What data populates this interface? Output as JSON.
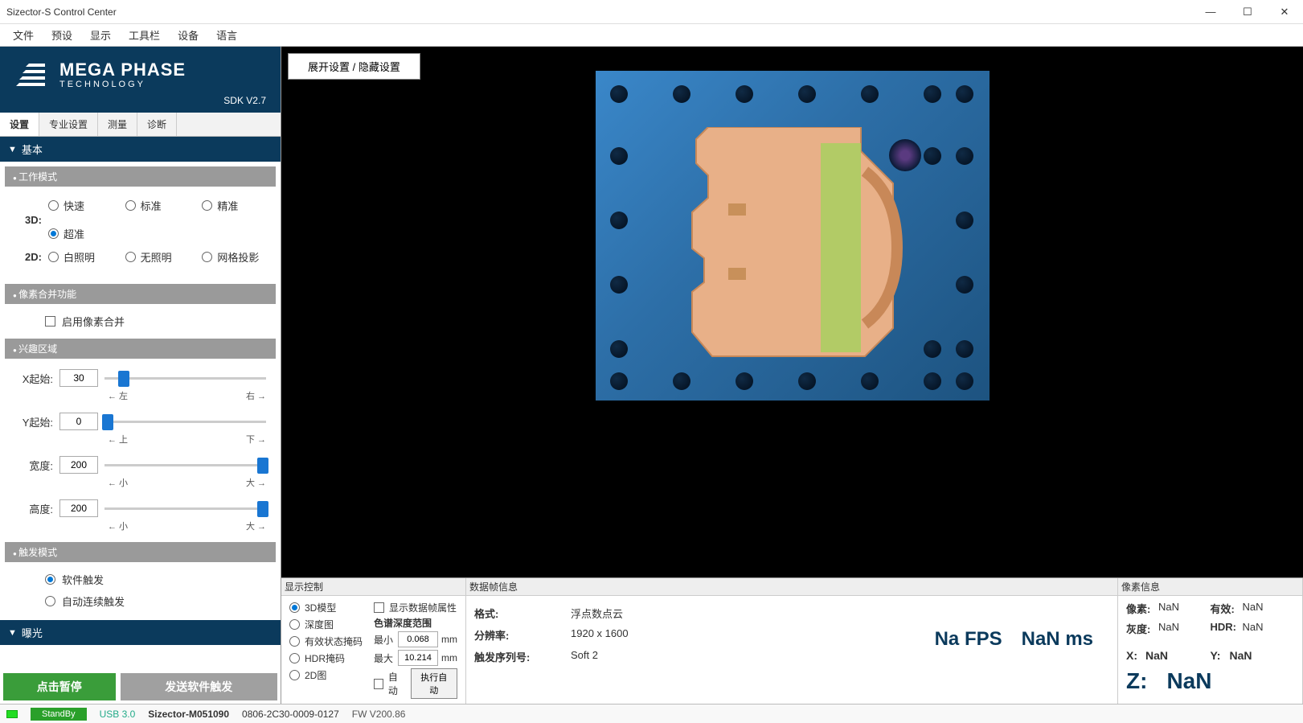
{
  "window": {
    "title": "Sizector-S Control Center"
  },
  "menu": {
    "file": "文件",
    "preset": "预设",
    "display": "显示",
    "toolbar": "工具栏",
    "device": "设备",
    "lang": "语言"
  },
  "logo": {
    "line1": "MEGA PHASE",
    "line2": "TECHNOLOGY",
    "sdk": "SDK V2.7"
  },
  "tabs": {
    "settings": "设置",
    "pro": "专业设置",
    "measure": "测量",
    "diag": "诊断"
  },
  "basic": {
    "header": "基本",
    "workmode_hdr": "工作模式",
    "label_3d": "3D:",
    "label_2d": "2D:",
    "m3d": {
      "fast": "快速",
      "std": "标准",
      "acc": "精准",
      "ultra": "超准"
    },
    "m2d": {
      "white": "白照明",
      "none": "无照明",
      "grid": "网格投影"
    },
    "binning_hdr": "像素合并功能",
    "binning_enable": "启用像素合并",
    "roi_hdr": "兴趣区域",
    "x_label": "X起始:",
    "x_value": "30",
    "x_left": "← 左",
    "x_right": "右 →",
    "y_label": "Y起始:",
    "y_value": "0",
    "y_up": "← 上",
    "y_down": "下 →",
    "w_label": "宽度:",
    "w_value": "200",
    "w_small": "← 小",
    "w_big": "大 →",
    "h_label": "高度:",
    "h_value": "200",
    "h_small": "← 小",
    "h_big": "大 →",
    "trigger_hdr": "触发模式",
    "trig_soft": "软件触发",
    "trig_auto": "自动连续触发"
  },
  "exposure_hdr": "曝光",
  "actions": {
    "pause": "点击暂停",
    "send_trigger": "发送软件触发"
  },
  "viewer": {
    "toggle": "展开设置 / 隐藏设置"
  },
  "display_ctrl": {
    "header": "显示控制",
    "model3d": "3D模型",
    "show_attr": "显示数据帧属性",
    "depth_hdr": "色谱深度范围",
    "depthmap": "深度图",
    "mask": "有效状态掩码",
    "hdr_mask": "HDR掩码",
    "img2d": "2D图",
    "min_lbl": "最小",
    "min_val": "0.068",
    "max_lbl": "最大",
    "max_val": "10.214",
    "unit": "mm",
    "auto": "自动",
    "run_auto": "执行自动"
  },
  "frameinfo": {
    "header": "数据帧信息",
    "fmt_k": "格式:",
    "fmt_v": "浮点数点云",
    "res_k": "分辨率:",
    "res_v": "1920 x 1600",
    "seq_k": "触发序列号:",
    "seq_v": "Soft 2",
    "fps_val": "Na",
    "fps_unit": "FPS",
    "ms_val": "NaN",
    "ms_unit": "ms"
  },
  "pixelinfo": {
    "header": "像素信息",
    "px_k": "像素:",
    "px_v": "NaN",
    "valid_k": "有效:",
    "valid_v": "NaN",
    "gray_k": "灰度:",
    "gray_v": "NaN",
    "hdr_k": "HDR:",
    "hdr_v": "NaN",
    "x_k": "X:",
    "x_v": "NaN",
    "y_k": "Y:",
    "y_v": "NaN",
    "z_k": "Z:",
    "z_v": "NaN"
  },
  "status": {
    "standby": "StandBy",
    "usb": "USB 3.0",
    "device": "Sizector-M051090",
    "serial": "0806-2C30-0009-0127",
    "fw": "FW V200.86"
  }
}
